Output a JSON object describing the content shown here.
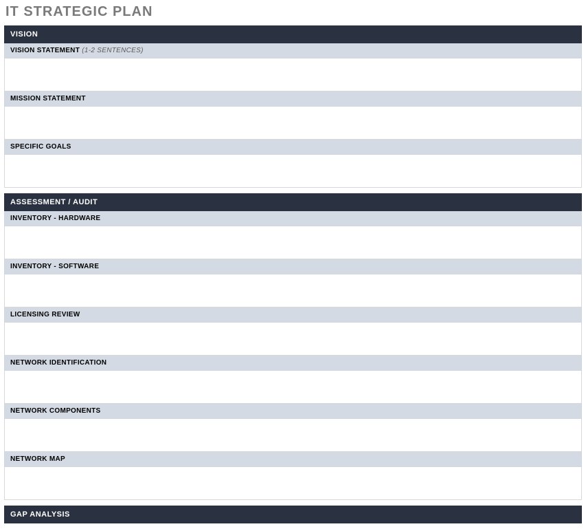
{
  "title": "IT STRATEGIC PLAN",
  "sections": [
    {
      "header": "VISION",
      "subs": [
        {
          "label": "VISION STATEMENT",
          "hint": "(1-2 SENTENCES)",
          "content": ""
        },
        {
          "label": "MISSION STATEMENT",
          "hint": "",
          "content": ""
        },
        {
          "label": "SPECIFIC GOALS",
          "hint": "",
          "content": ""
        }
      ]
    },
    {
      "header": "ASSESSMENT / AUDIT",
      "subs": [
        {
          "label": "INVENTORY - HARDWARE",
          "hint": "",
          "content": ""
        },
        {
          "label": "INVENTORY - SOFTWARE",
          "hint": "",
          "content": ""
        },
        {
          "label": "LICENSING REVIEW",
          "hint": "",
          "content": ""
        },
        {
          "label": "NETWORK IDENTIFICATION",
          "hint": "",
          "content": ""
        },
        {
          "label": "NETWORK COMPONENTS",
          "hint": "",
          "content": ""
        },
        {
          "label": "NETWORK MAP",
          "hint": "",
          "content": ""
        }
      ]
    },
    {
      "header": "GAP ANALYSIS",
      "subs": []
    }
  ]
}
